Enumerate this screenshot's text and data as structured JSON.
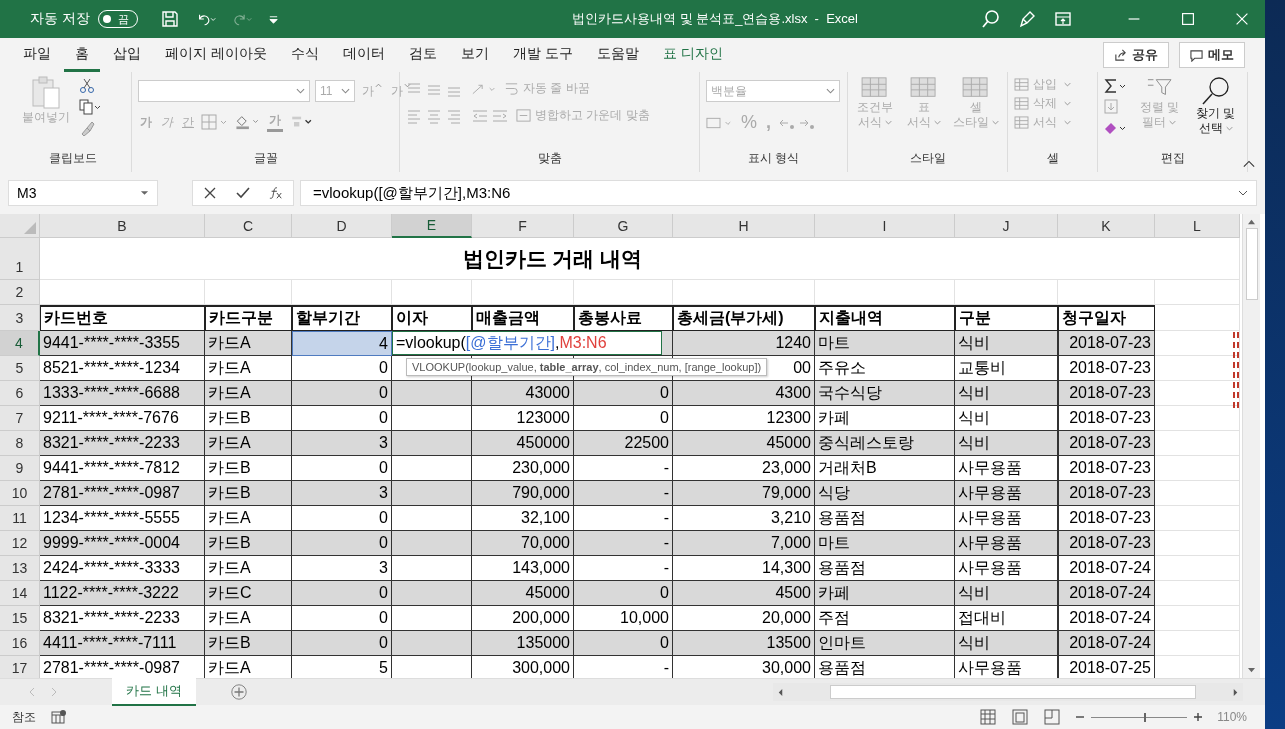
{
  "titlebar": {
    "autosave_label": "자동 저장",
    "autosave_on": false,
    "autosave_state": "끔",
    "title": "법인카드사용내역 및 분석표_연습용.xlsx  -  Excel"
  },
  "menu": [
    {
      "label": "파일",
      "selected": false,
      "kind": "tab"
    },
    {
      "label": "홈",
      "selected": true,
      "kind": "tab"
    },
    {
      "label": "삽입",
      "selected": false,
      "kind": "tab"
    },
    {
      "label": "페이지 레이아웃",
      "selected": false,
      "kind": "tab"
    },
    {
      "label": "수식",
      "selected": false,
      "kind": "tab"
    },
    {
      "label": "데이터",
      "selected": false,
      "kind": "tab"
    },
    {
      "label": "검토",
      "selected": false,
      "kind": "tab"
    },
    {
      "label": "보기",
      "selected": false,
      "kind": "tab"
    },
    {
      "label": "개발 도구",
      "selected": false,
      "kind": "tab"
    },
    {
      "label": "도움말",
      "selected": false,
      "kind": "tab"
    },
    {
      "label": "표 디자인",
      "selected": false,
      "kind": "context"
    }
  ],
  "share_button": "공유",
  "comment_button": "메모",
  "ribbon": {
    "clipboard": {
      "label": "클립보드",
      "paste": "붙여넣기",
      "disabled": true
    },
    "font": {
      "label": "글꼴",
      "size": "11",
      "grow": "가",
      "shrink": "가",
      "bold": "가",
      "italic": "가",
      "underline": "간",
      "font_color": "가",
      "disabled": true
    },
    "alignment": {
      "label": "맞춤",
      "wrap": "자동 줄 바꿈",
      "merge": "병합하고 가운데 맞춤",
      "disabled": true
    },
    "number": {
      "label": "표시 형식",
      "format": "백분율",
      "percent": "%",
      "comma": ",",
      "disabled": true
    },
    "styles": {
      "label": "스타일",
      "buttons": [
        {
          "line1": "조건부",
          "line2": "서식"
        },
        {
          "line1": "표",
          "line2": "서식"
        },
        {
          "line1": "셀",
          "line2": "스타일"
        }
      ],
      "disabled": true
    },
    "cells": {
      "label": "셀",
      "buttons": [
        "삽입",
        "삭제",
        "서식"
      ],
      "disabled": true
    },
    "editing": {
      "label": "편집",
      "items": [
        {
          "line1": "정렬 및",
          "line2": "필터",
          "disabled": true
        },
        {
          "line1": "찾기 및",
          "line2": "선택",
          "disabled": false
        }
      ]
    }
  },
  "formula_bar": {
    "name_box": "M3",
    "formula": "=vlookup([@할부기간],M3:N6"
  },
  "cell_edit": [
    {
      "text": "=vlookup("
    },
    {
      "text": "[@할부기간]",
      "color": "#3b6fd6"
    },
    {
      "text": ","
    },
    {
      "text": "M3:N6",
      "color": "#e0413c"
    }
  ],
  "tooltip": "VLOOKUP(lookup_value, **table_array**, col_index_num, [range_lookup])",
  "columns": [
    {
      "label": "B",
      "selected": false
    },
    {
      "label": "C",
      "selected": false
    },
    {
      "label": "D",
      "selected": false
    },
    {
      "label": "E",
      "selected": true
    },
    {
      "label": "F",
      "selected": false
    },
    {
      "label": "G",
      "selected": false
    },
    {
      "label": "H",
      "selected": false
    },
    {
      "label": "I",
      "selected": false
    },
    {
      "label": "J",
      "selected": false
    },
    {
      "label": "K",
      "selected": false
    },
    {
      "label": "L",
      "selected": false
    }
  ],
  "sheet_title": {
    "row": "1",
    "text": "법인카드 거래 내역"
  },
  "empty_row": "2",
  "header": {
    "row": "3",
    "cells": [
      "카드번호",
      "카드구분",
      "할부기간",
      "이자",
      "매출금액",
      "총봉사료",
      "총세금(부가세)",
      "지출내역",
      "구분",
      "청구일자"
    ]
  },
  "rows": [
    {
      "num": "4",
      "selected": true,
      "highlighted": true,
      "cells": [
        "9441-****-****-3355",
        "카드A",
        "4",
        "",
        "",
        "",
        "1240",
        "마트",
        "식비",
        "2018-07-23"
      ]
    },
    {
      "num": "5",
      "selected": false,
      "highlighted": false,
      "cells": [
        "8521-****-****-1234",
        "카드A",
        "0",
        "",
        "",
        "",
        "00",
        "주유소",
        "교통비",
        "2018-07-23"
      ]
    },
    {
      "num": "6",
      "selected": false,
      "highlighted": false,
      "cells": [
        "1333-****-****-6688",
        "카드A",
        "0",
        "",
        "43000",
        "0",
        "4300",
        "국수식당",
        "식비",
        "2018-07-23"
      ]
    },
    {
      "num": "7",
      "selected": false,
      "highlighted": false,
      "cells": [
        "9211-****-****-7676",
        "카드B",
        "0",
        "",
        "123000",
        "0",
        "12300",
        "카페",
        "식비",
        "2018-07-23"
      ]
    },
    {
      "num": "8",
      "selected": false,
      "highlighted": false,
      "cells": [
        "8321-****-****-2233",
        "카드A",
        "3",
        "",
        "450000",
        "22500",
        "45000",
        "중식레스토랑",
        "식비",
        "2018-07-23"
      ]
    },
    {
      "num": "9",
      "selected": false,
      "highlighted": false,
      "cells": [
        "9441-****-****-7812",
        "카드B",
        "0",
        "",
        "230,000",
        "-",
        "23,000",
        "거래처B",
        "사무용품",
        "2018-07-23"
      ]
    },
    {
      "num": "10",
      "selected": false,
      "highlighted": false,
      "cells": [
        "2781-****-****-0987",
        "카드B",
        "3",
        "",
        "790,000",
        "-",
        "79,000",
        "식당",
        "사무용품",
        "2018-07-23"
      ]
    },
    {
      "num": "11",
      "selected": false,
      "highlighted": false,
      "cells": [
        "1234-****-****-5555",
        "카드A",
        "0",
        "",
        "32,100",
        "-",
        "3,210",
        "용품점",
        "사무용품",
        "2018-07-23"
      ]
    },
    {
      "num": "12",
      "selected": false,
      "highlighted": false,
      "cells": [
        "9999-****-****-0004",
        "카드B",
        "0",
        "",
        "70,000",
        "-",
        "7,000",
        "마트",
        "사무용품",
        "2018-07-23"
      ]
    },
    {
      "num": "13",
      "selected": false,
      "highlighted": false,
      "cells": [
        "2424-****-****-3333",
        "카드A",
        "3",
        "",
        "143,000",
        "-",
        "14,300",
        "용품점",
        "사무용품",
        "2018-07-24"
      ]
    },
    {
      "num": "14",
      "selected": false,
      "highlighted": false,
      "cells": [
        "1122-****-****-3222",
        "카드C",
        "0",
        "",
        "45000",
        "0",
        "4500",
        "카페",
        "식비",
        "2018-07-24"
      ]
    },
    {
      "num": "15",
      "selected": false,
      "highlighted": false,
      "cells": [
        "8321-****-****-2233",
        "카드A",
        "0",
        "",
        "200,000",
        "10,000",
        "20,000",
        "주점",
        "접대비",
        "2018-07-24"
      ]
    },
    {
      "num": "16",
      "selected": false,
      "highlighted": false,
      "cells": [
        "4411-****-****-7111",
        "카드B",
        "0",
        "",
        "135000",
        "0",
        "13500",
        "인마트",
        "식비",
        "2018-07-24"
      ]
    },
    {
      "num": "17",
      "selected": false,
      "highlighted": false,
      "cells": [
        "2781-****-****-0987",
        "카드A",
        "5",
        "",
        "300,000",
        "-",
        "30,000",
        "용품점",
        "사무용품",
        "2018-07-25"
      ]
    }
  ],
  "sheet_tabs": [
    {
      "label": "카드 내역",
      "selected": true
    }
  ],
  "status": {
    "mode": "참조",
    "zoom": "110%",
    "level": 0.55
  }
}
